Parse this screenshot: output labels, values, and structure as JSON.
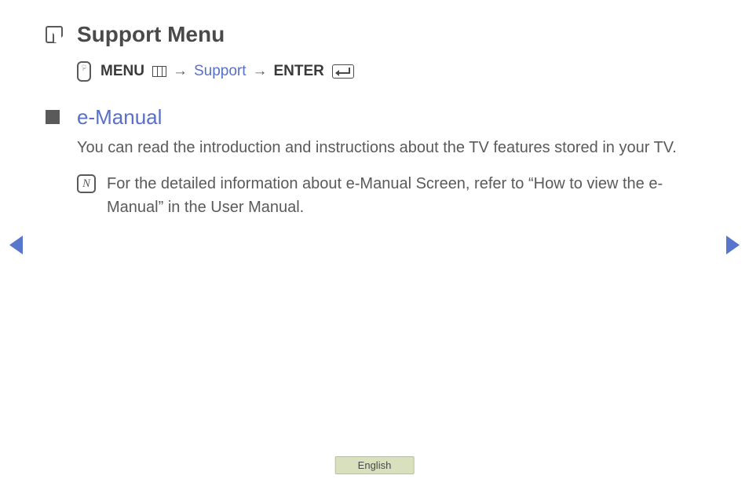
{
  "title": "Support Menu",
  "breadcrumb": {
    "menu_label": "MENU",
    "arrow": "→",
    "support_label": "Support",
    "enter_label": "ENTER"
  },
  "section": {
    "heading": "e-Manual",
    "body": "You can read the introduction and instructions about the TV features stored in your TV.",
    "note": "For the detailed information about e-Manual Screen, refer to “How to view the e-Manual” in the User Manual."
  },
  "language": "English"
}
